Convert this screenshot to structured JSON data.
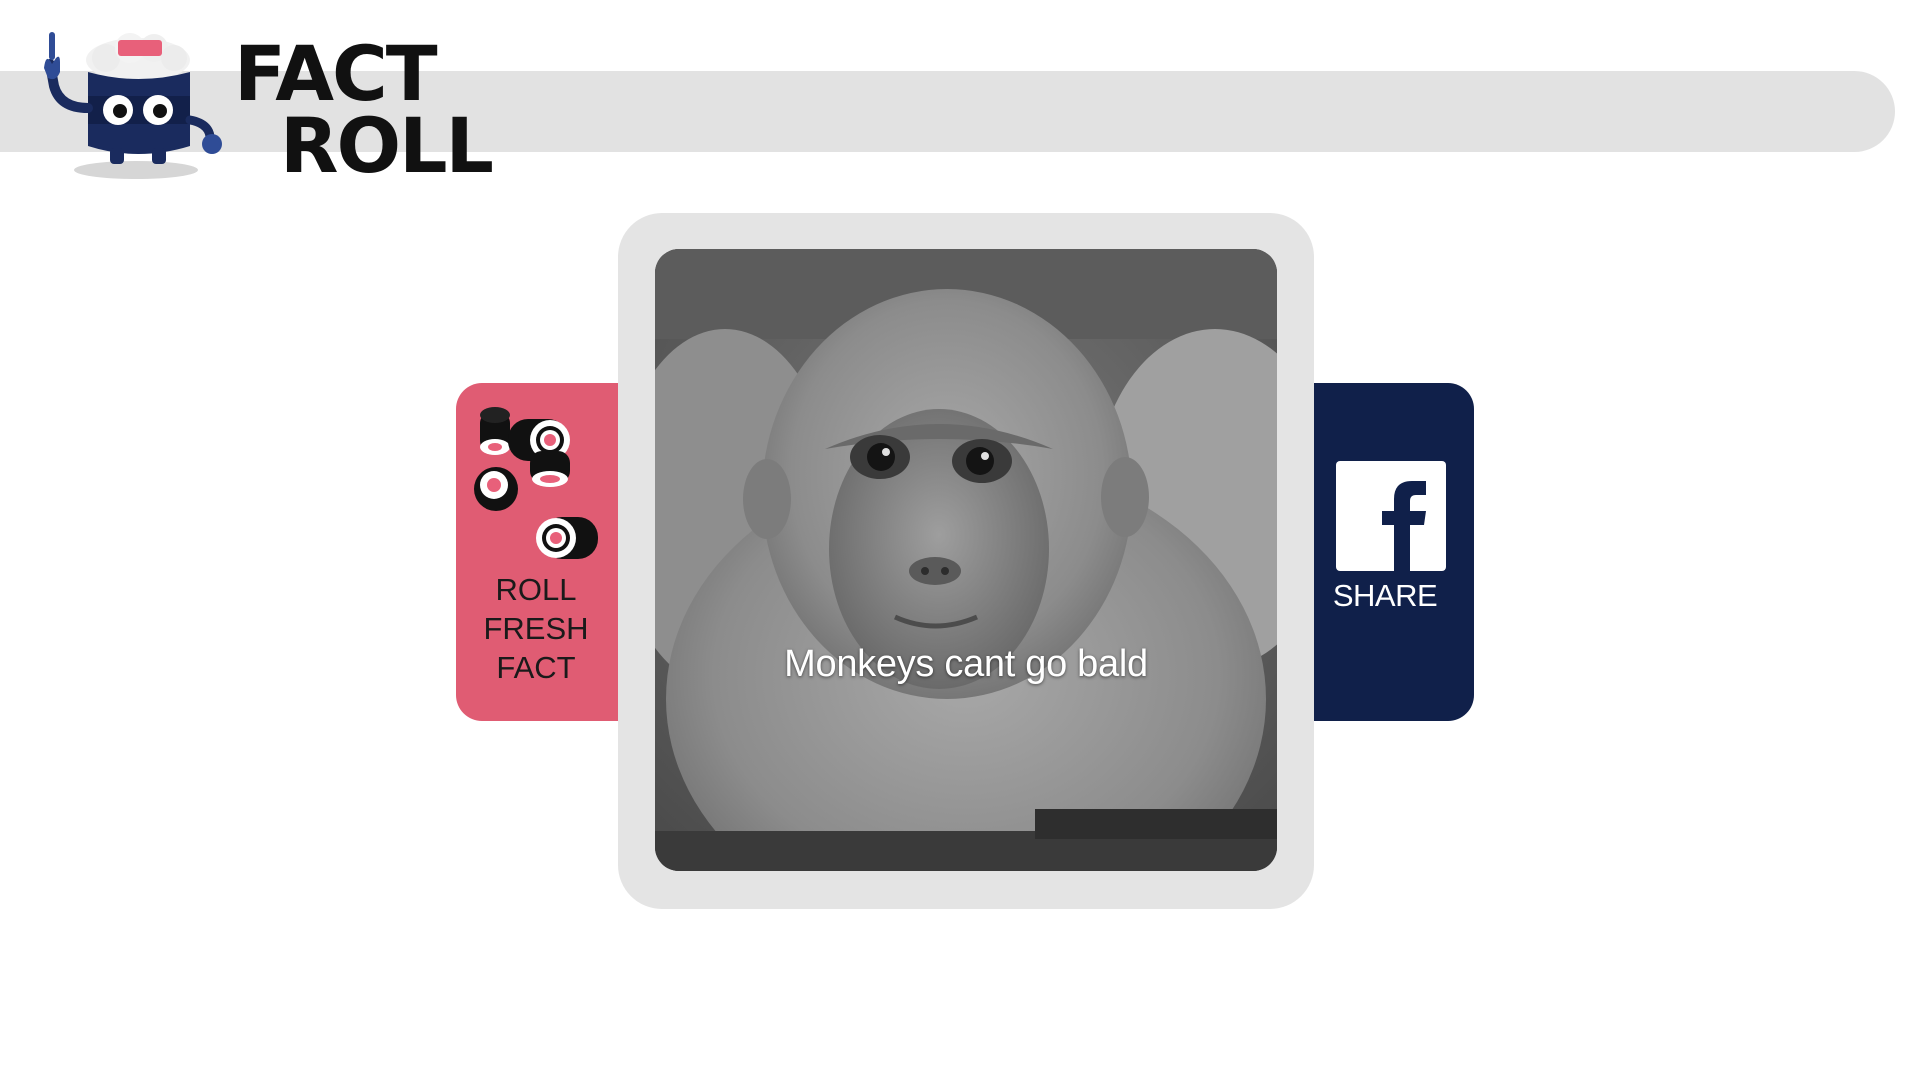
{
  "logo": {
    "line1": "FACT",
    "line2": "ROLL"
  },
  "roll_button": {
    "label_lines": [
      "ROLL",
      "FRESH",
      "FACT"
    ],
    "icon": "sushi-rolls-icon"
  },
  "share_button": {
    "label": "SHARE",
    "icon": "facebook-icon"
  },
  "fact": {
    "text": "Monkeys cant go bald",
    "image": "monkey-photo"
  },
  "colors": {
    "header_bar": "#e2e2e2",
    "roll_panel": "#e05c73",
    "share_panel": "#10204a",
    "card_frame": "#e4e4e4",
    "logo_navy": "#1a2b5e"
  }
}
